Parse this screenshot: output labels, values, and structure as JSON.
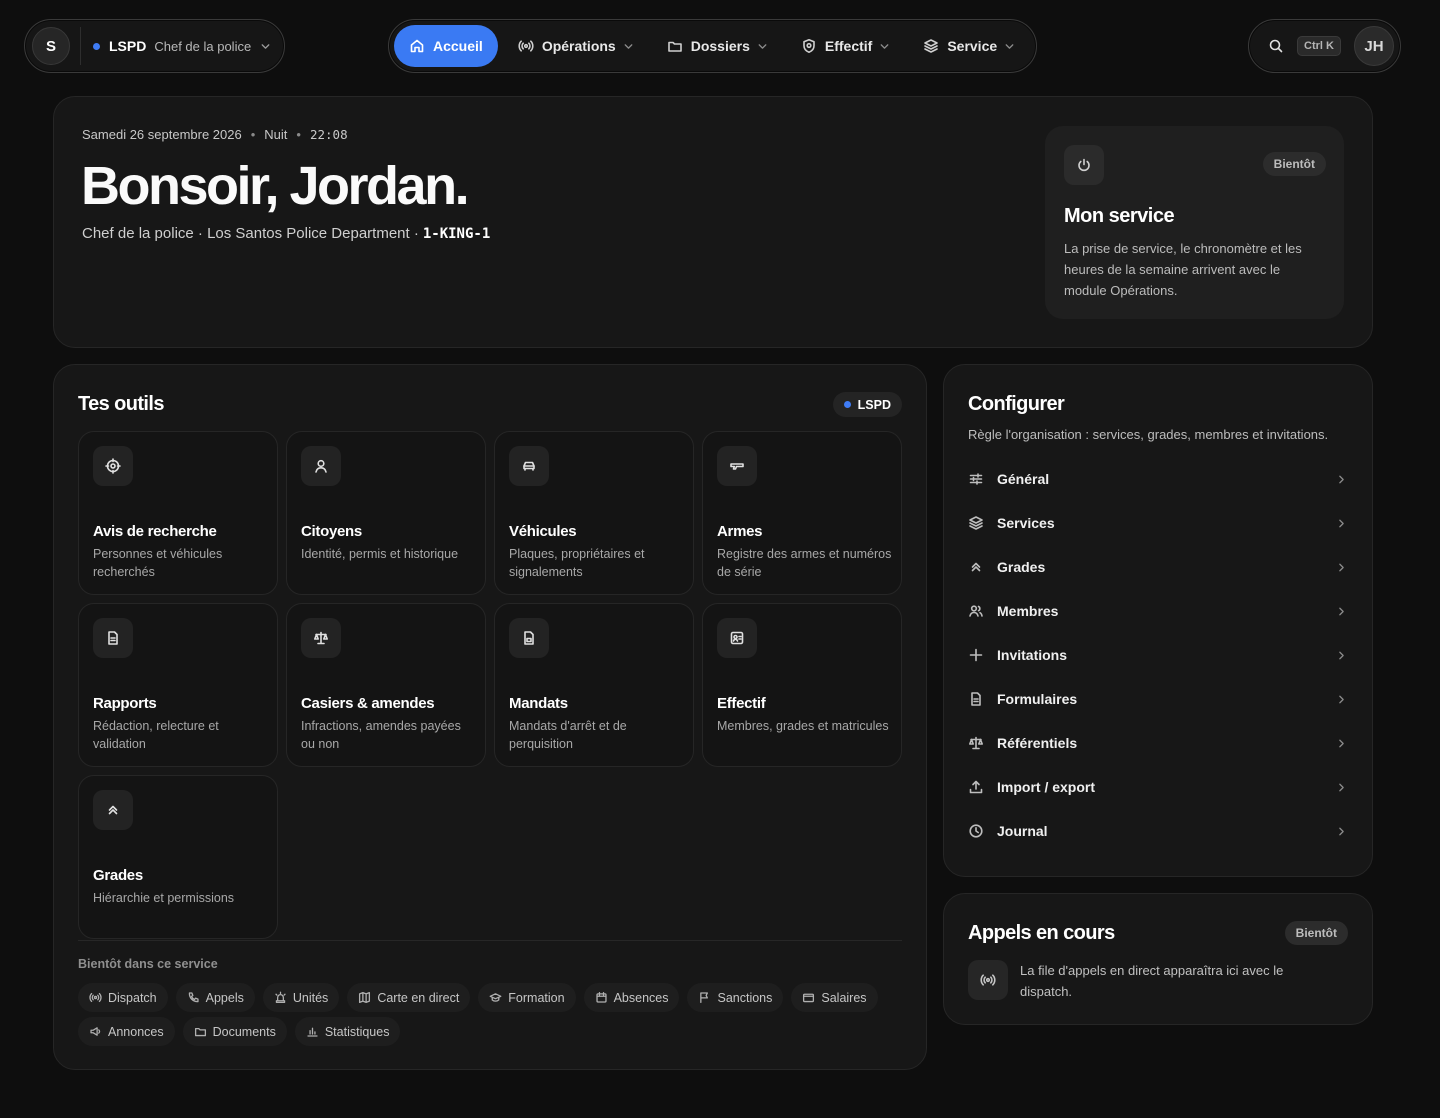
{
  "topbar": {
    "org": {
      "avatar_letter": "S",
      "name": "LSPD",
      "role": "Chef de la police",
      "dot_color": "#3f7cf5"
    },
    "nav": [
      {
        "label": "Accueil",
        "icon": "home-icon",
        "active": true,
        "has_menu": false
      },
      {
        "label": "Opérations",
        "icon": "broadcast-icon",
        "active": false,
        "has_menu": true
      },
      {
        "label": "Dossiers",
        "icon": "folder-icon",
        "active": false,
        "has_menu": true
      },
      {
        "label": "Effectif",
        "icon": "shield-icon",
        "active": false,
        "has_menu": true
      },
      {
        "label": "Service",
        "icon": "layers-icon",
        "active": false,
        "has_menu": true
      }
    ],
    "search": {
      "shortcut": "Ctrl K"
    },
    "user": {
      "initials": "JH"
    },
    "accent_color": "#3a7af3"
  },
  "hero": {
    "date": "Samedi 26 septembre 2026",
    "period": "Nuit",
    "time": "22:08",
    "greeting": "Bonsoir, Jordan.",
    "subtitle": "Chef de la police · Los Santos Police Department ·",
    "callsign": "1-KING-1",
    "service": {
      "badge": "Bientôt",
      "title": "Mon service",
      "description": "La prise de service, le chronomètre et les heures de la semaine arrivent avec le module Opérations."
    }
  },
  "tools": {
    "title": "Tes outils",
    "badge": "LSPD",
    "items": [
      {
        "title": "Avis de recherche",
        "desc": "Personnes et véhicules recherchés",
        "icon": "target-icon"
      },
      {
        "title": "Citoyens",
        "desc": "Identité, permis et historique",
        "icon": "user-icon"
      },
      {
        "title": "Véhicules",
        "desc": "Plaques, propriétaires et signalements",
        "icon": "car-icon"
      },
      {
        "title": "Armes",
        "desc": "Registre des armes et numéros de série",
        "icon": "gun-icon"
      },
      {
        "title": "Rapports",
        "desc": "Rédaction, relecture et validation",
        "icon": "file-text-icon"
      },
      {
        "title": "Casiers & amendes",
        "desc": "Infractions, amendes payées ou non",
        "icon": "scale-icon"
      },
      {
        "title": "Mandats",
        "desc": "Mandats d'arrêt et de perquisition",
        "icon": "file-check-icon"
      },
      {
        "title": "Effectif",
        "desc": "Membres, grades et matricules",
        "icon": "id-card-icon"
      },
      {
        "title": "Grades",
        "desc": "Hiérarchie et permissions",
        "icon": "chevrons-up-icon"
      }
    ],
    "soon_label": "Bientôt dans ce service",
    "soon": [
      {
        "label": "Dispatch",
        "icon": "broadcast-icon"
      },
      {
        "label": "Appels",
        "icon": "phone-icon"
      },
      {
        "label": "Unités",
        "icon": "siren-icon"
      },
      {
        "label": "Carte en direct",
        "icon": "map-icon"
      },
      {
        "label": "Formation",
        "icon": "graduation-icon"
      },
      {
        "label": "Absences",
        "icon": "calendar-icon"
      },
      {
        "label": "Sanctions",
        "icon": "flag-icon"
      },
      {
        "label": "Salaires",
        "icon": "wallet-icon"
      },
      {
        "label": "Annonces",
        "icon": "megaphone-icon"
      },
      {
        "label": "Documents",
        "icon": "folder-icon"
      },
      {
        "label": "Statistiques",
        "icon": "bar-chart-icon"
      }
    ]
  },
  "config": {
    "title": "Configurer",
    "description": "Règle l'organisation : services, grades, membres et invitations.",
    "items": [
      {
        "label": "Général",
        "icon": "sliders-icon"
      },
      {
        "label": "Services",
        "icon": "layers-icon"
      },
      {
        "label": "Grades",
        "icon": "chevrons-up-icon"
      },
      {
        "label": "Membres",
        "icon": "users-icon"
      },
      {
        "label": "Invitations",
        "icon": "plus-icon"
      },
      {
        "label": "Formulaires",
        "icon": "file-text-icon"
      },
      {
        "label": "Référentiels",
        "icon": "scale-icon"
      },
      {
        "label": "Import / export",
        "icon": "upload-icon"
      },
      {
        "label": "Journal",
        "icon": "clock-icon"
      }
    ]
  },
  "calls": {
    "title": "Appels en cours",
    "badge": "Bientôt",
    "description": "La file d'appels en direct apparaîtra ici avec le dispatch."
  }
}
